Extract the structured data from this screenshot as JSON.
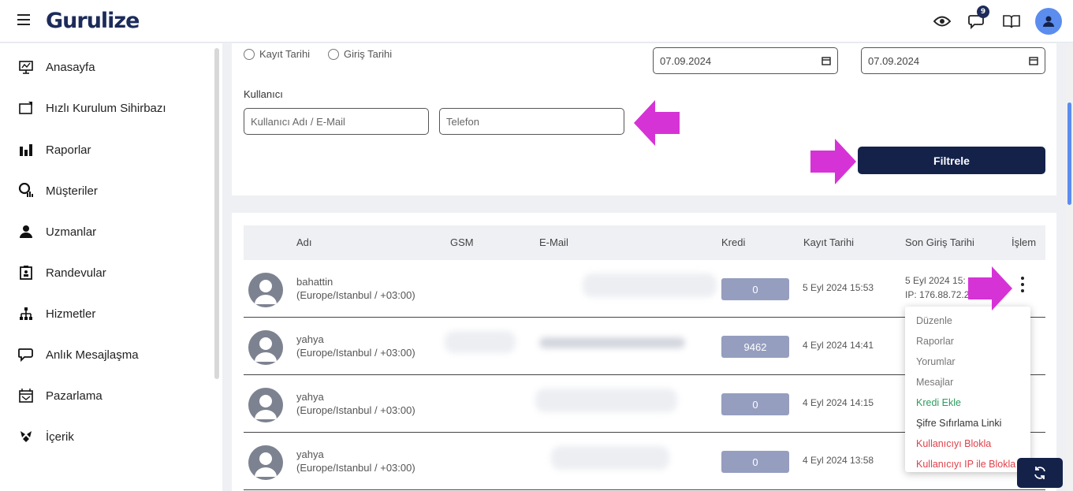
{
  "header": {
    "logo": "Gurulize",
    "badge_count": "9",
    "icons": [
      "menu-icon",
      "eye-icon",
      "chat-icon",
      "book-icon",
      "user-icon"
    ]
  },
  "sidebar": {
    "items": [
      {
        "label": "Anasayfa",
        "icon": "dashboard-icon"
      },
      {
        "label": "Hızlı Kurulum Sihirbazı",
        "icon": "wizard-icon"
      },
      {
        "label": "Raporlar",
        "icon": "bar-chart-icon"
      },
      {
        "label": "Müşteriler",
        "icon": "customers-icon"
      },
      {
        "label": "Uzmanlar",
        "icon": "experts-icon"
      },
      {
        "label": "Randevular",
        "icon": "appointment-icon"
      },
      {
        "label": "Hizmetler",
        "icon": "services-icon"
      },
      {
        "label": "Anlık Mesajlaşma",
        "icon": "chat-icon"
      },
      {
        "label": "Pazarlama",
        "icon": "marketing-icon"
      },
      {
        "label": "İçerik",
        "icon": "content-icon"
      }
    ]
  },
  "filters": {
    "radio_register": "Kayıt Tarihi",
    "radio_login": "Giriş Tarihi",
    "date_from": "07.09.2024",
    "date_to": "07.09.2024",
    "user_label": "Kullanıcı",
    "username_placeholder": "Kullanıcı Adı / E-Mail",
    "phone_placeholder": "Telefon",
    "filter_button": "Filtrele"
  },
  "table": {
    "headers": {
      "name": "Adı",
      "gsm": "GSM",
      "email": "E-Mail",
      "credit": "Kredi",
      "register": "Kayıt Tarihi",
      "last_login": "Son Giriş Tarihi",
      "action": "İşlem"
    },
    "rows": [
      {
        "name": "bahattin",
        "tz": "(Europe/Istanbul / +03:00)",
        "credit": "0",
        "register": "5 Eyl 2024 15:53",
        "login": "5 Eyl 2024 15:",
        "ip": "IP: 176.88.72.2"
      },
      {
        "name": "yahya",
        "tz": "(Europe/Istanbul / +03:00)",
        "credit": "9462",
        "register": "4 Eyl 2024 14:41",
        "login": "",
        "ip": ""
      },
      {
        "name": "yahya",
        "tz": "(Europe/Istanbul / +03:00)",
        "credit": "0",
        "register": "4 Eyl 2024 14:15",
        "login": "",
        "ip": ""
      },
      {
        "name": "yahya",
        "tz": "(Europe/Istanbul / +03:00)",
        "credit": "0",
        "register": "4 Eyl 2024 13:58",
        "login": "",
        "ip": ""
      }
    ]
  },
  "action_menu": {
    "edit": "Düzenle",
    "reports": "Raporlar",
    "comments": "Yorumlar",
    "messages": "Mesajlar",
    "add_credit": "Kredi Ekle",
    "reset_link": "Şifre Sıfırlama Linki",
    "block_user": "Kullanıcıyı Blokla",
    "block_ip": "Kullanıcıyı IP ile Blokla"
  },
  "colors": {
    "navy": "#14224a",
    "arrow": "#d633d6",
    "credit": "#959ebf",
    "green": "#2e9a5e",
    "red": "#e0404a"
  }
}
